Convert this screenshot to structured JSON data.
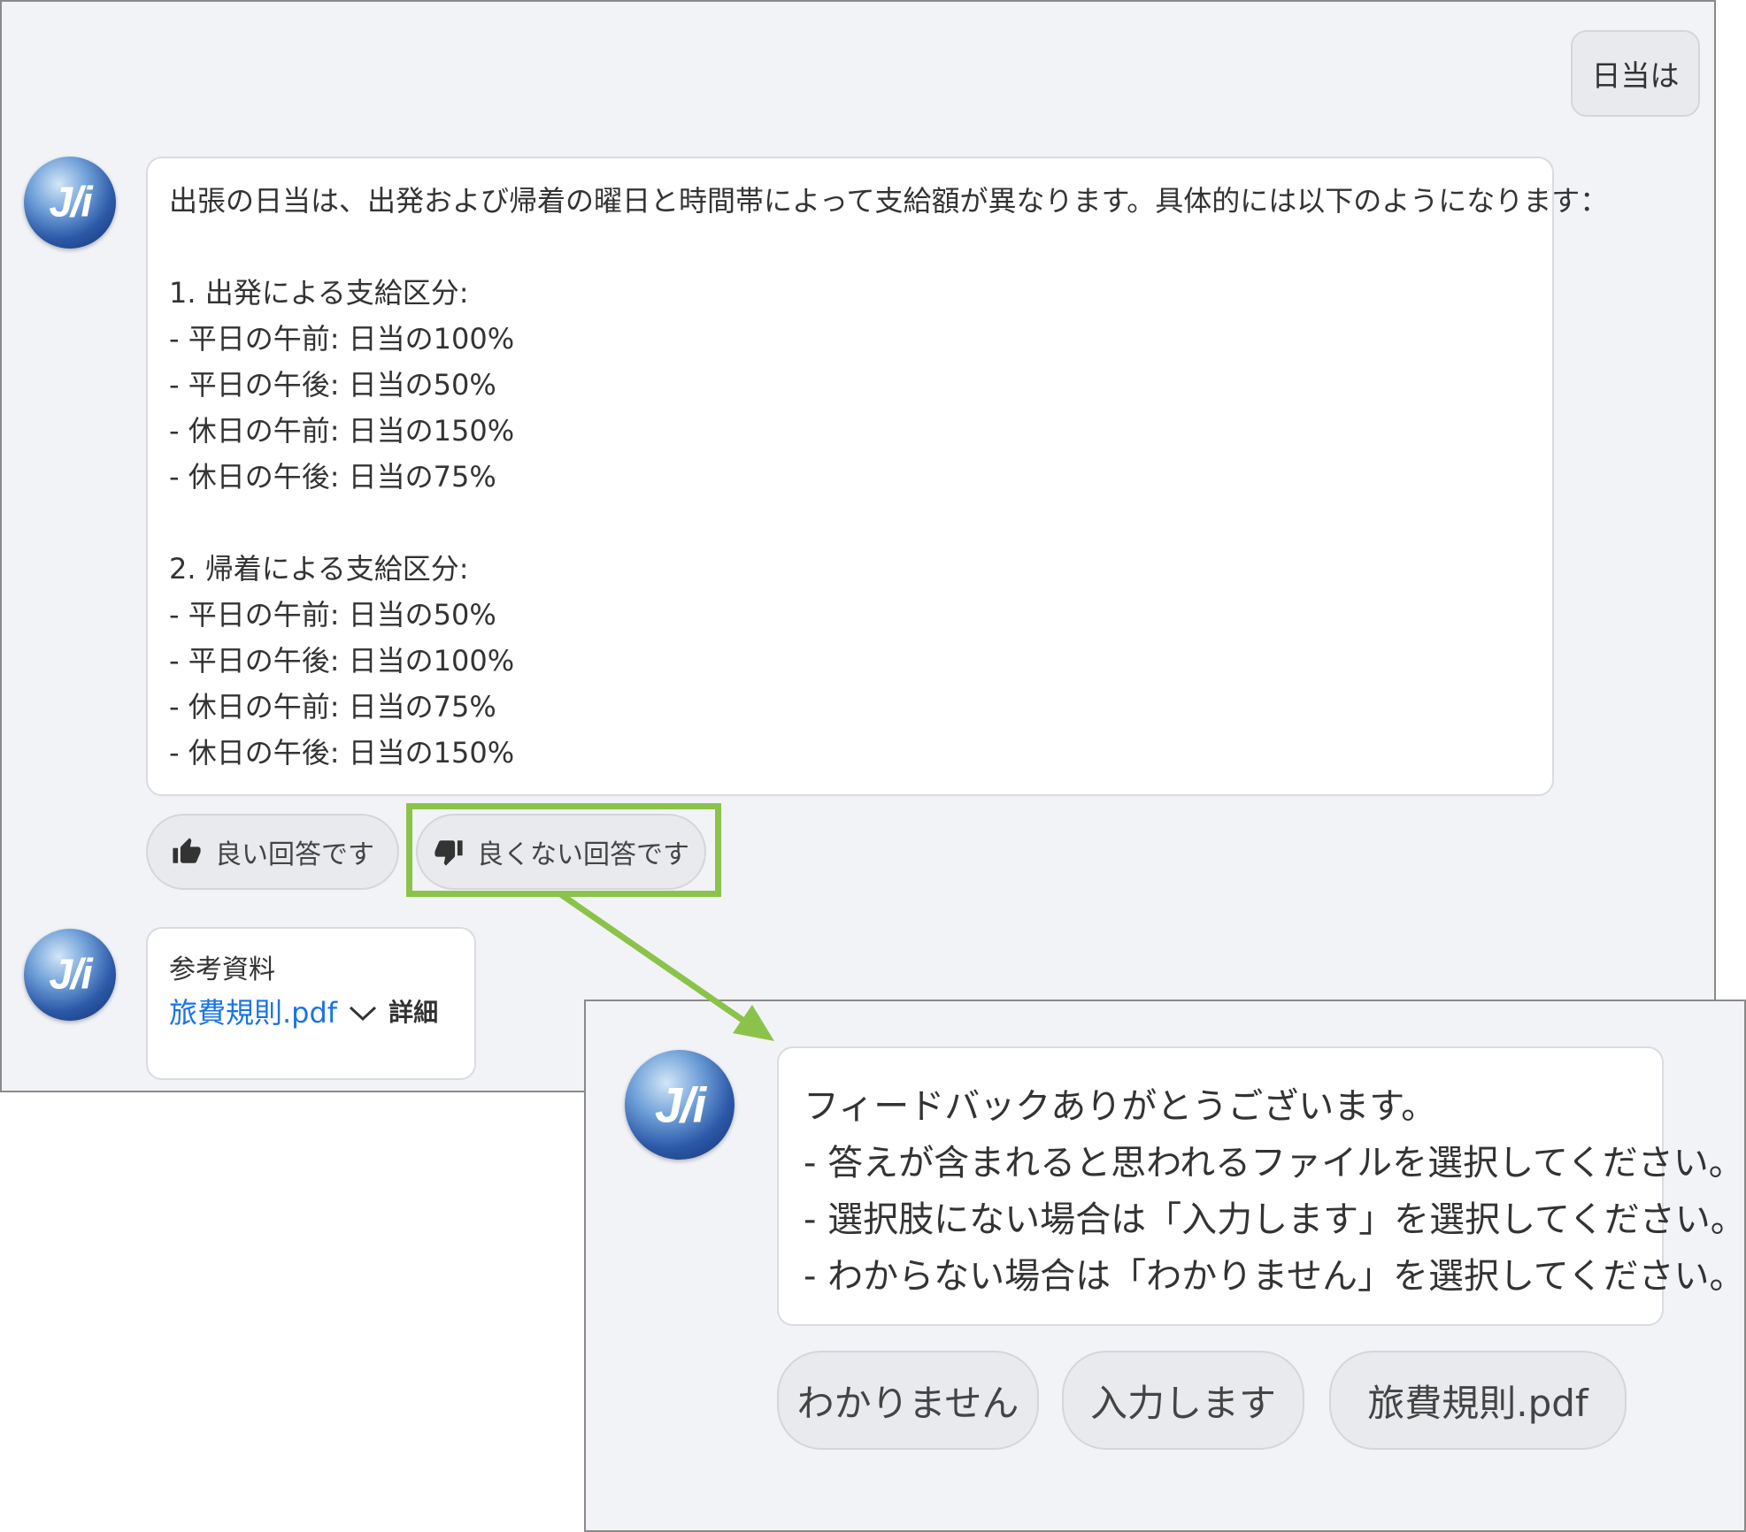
{
  "chat": {
    "user_message": "日当は",
    "avatar_logo": "J/i",
    "answer_lines": [
      "出張の日当は、出発および帰着の曜日と時間帯によって支給額が異なります。具体的には以下のようになります：",
      "",
      "1. 出発による支給区分:",
      "- 平日の午前: 日当の100%",
      "- 平日の午後: 日当の50%",
      "- 休日の午前: 日当の150%",
      "- 休日の午後: 日当の75%",
      "",
      "2. 帰着による支給区分:",
      "- 平日の午前: 日当の50%",
      "- 平日の午後: 日当の100%",
      "- 休日の午前: 日当の75%",
      "- 休日の午後: 日当の150%"
    ],
    "good_label": "良い回答です",
    "bad_label": "良くない回答です",
    "reference": {
      "title": "参考資料",
      "file": "旅費規則.pdf",
      "detail": "詳細"
    }
  },
  "feedback": {
    "lines": [
      "フィードバックありがとうございます。",
      "- 答えが含まれると思われるファイルを選択してください。",
      "- 選択肢にない場合は「入力します」を選択してください。",
      "- わからない場合は「わかりません」を選択してください。"
    ],
    "choices": [
      "わかりません",
      "入力します",
      "旅費規則.pdf"
    ]
  },
  "colors": {
    "highlight": "#8bc34a",
    "link": "#1a73e8",
    "panel_bg": "#f2f3f7"
  },
  "icons": [
    "thumbs-up-icon",
    "thumbs-down-icon",
    "chevron-down-icon",
    "arrow-icon"
  ]
}
